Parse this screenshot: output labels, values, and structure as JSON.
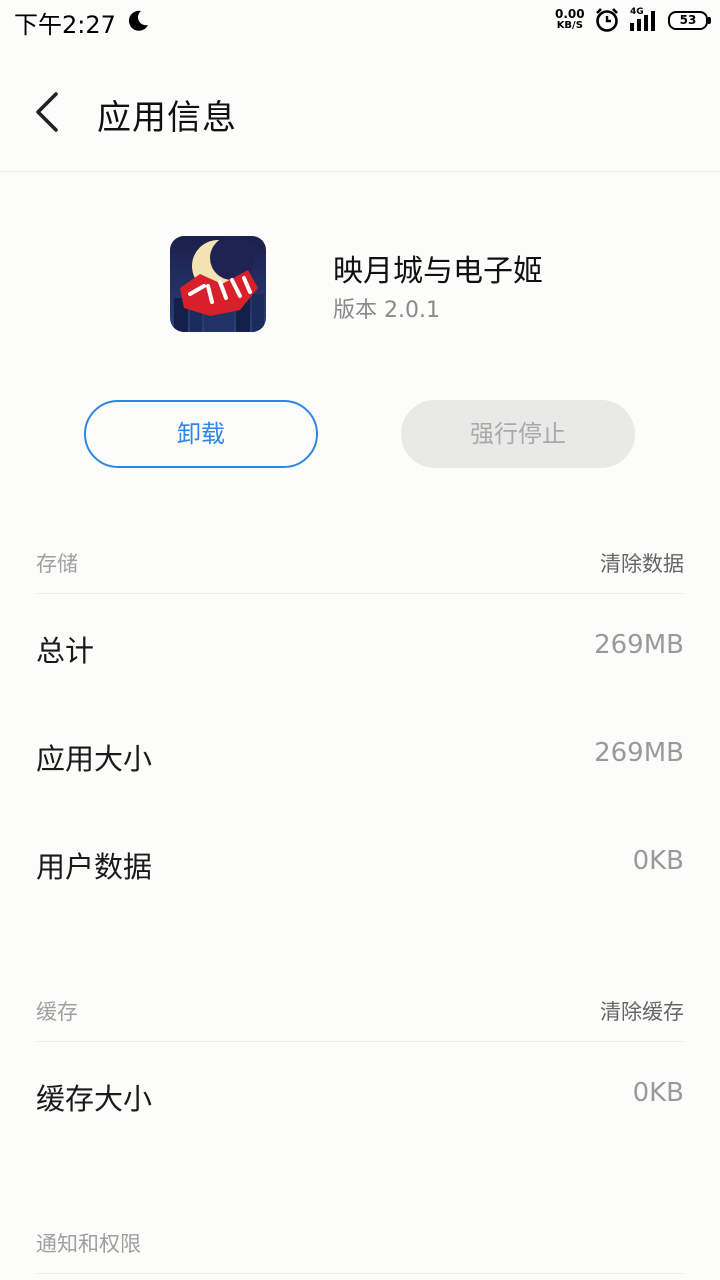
{
  "status_bar": {
    "time": "下午2:27",
    "speed_value": "0.00",
    "speed_unit": "KB/S",
    "network_label": "4G",
    "battery": "53",
    "icons": [
      "moon-icon",
      "alarm-icon",
      "signal-icon",
      "battery-icon"
    ]
  },
  "header": {
    "title": "应用信息",
    "back_icon": "chevron-left-icon"
  },
  "app": {
    "name": "映月城与电子姬",
    "version": "版本 2.0.1"
  },
  "actions": {
    "uninstall_label": "卸载",
    "force_stop_label": "强行停止"
  },
  "storage": {
    "title": "存储",
    "action": "清除数据",
    "rows": [
      {
        "label": "总计",
        "value": "269MB"
      },
      {
        "label": "应用大小",
        "value": "269MB"
      },
      {
        "label": "用户数据",
        "value": "0KB"
      }
    ]
  },
  "cache": {
    "title": "缓存",
    "action": "清除缓存",
    "rows": [
      {
        "label": "缓存大小",
        "value": "0KB"
      }
    ]
  },
  "permissions": {
    "title": "通知和权限"
  },
  "colors": {
    "accent": "#2f86e6",
    "background": "#fcfcfa",
    "disabled_button": "#e9e9e7"
  }
}
